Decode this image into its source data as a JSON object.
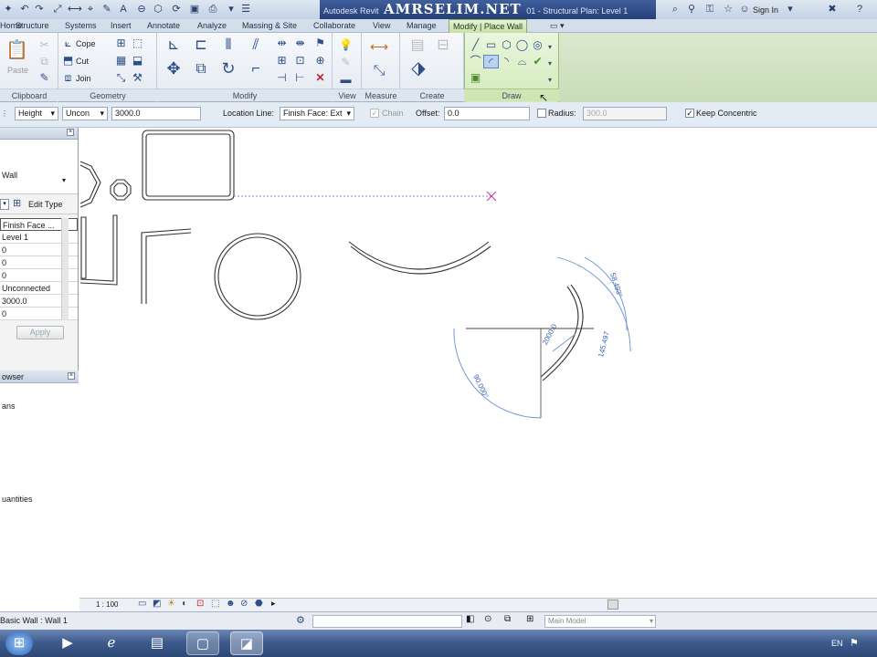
{
  "titlebar": {
    "app_text": "Autodesk Revit",
    "watermark": "AMRSELIM.NET",
    "doc_text": "01 - Structural Plan: Level 1",
    "sign_in": "Sign In",
    "quick_access_icons": [
      "app-menu-icon",
      "undo-icon",
      "redo-icon",
      "measure-icon",
      "text-annotation-icon",
      "section-icon",
      "3d-view-icon",
      "print-icon"
    ]
  },
  "tabs": [
    "Home",
    "Structure",
    "Systems",
    "Insert",
    "Annotate",
    "Analyze",
    "Massing & Site",
    "Collaborate",
    "View",
    "Manage",
    "Modify | Place Wall"
  ],
  "active_tab": "Modify | Place Wall",
  "ribbon": {
    "clipboard": {
      "label": "Clipboard",
      "paste": "Paste"
    },
    "geometry": {
      "label": "Geometry",
      "cope": "Cope",
      "cut": "Cut",
      "join": "Join"
    },
    "modify": {
      "label": "Modify"
    },
    "view": {
      "label": "View"
    },
    "measure": {
      "label": "Measure"
    },
    "create": {
      "label": "Create"
    },
    "draw": {
      "label": "Draw"
    }
  },
  "options_bar": {
    "height_select": "Height",
    "uncon_select": "Uncon",
    "height_value": "3000.0",
    "location_line_label": "Location Line:",
    "location_line_value": "Finish Face: Ext",
    "chain_label": "Chain",
    "offset_label": "Offset:",
    "offset_value": "0.0",
    "radius_label": "Radius:",
    "radius_value": "300.0",
    "keep_concentric_label": "Keep Concentric"
  },
  "properties": {
    "type_text": "Wall",
    "edit_type": "Edit Type",
    "rows": [
      "Finish Face ...",
      "Level 1",
      "0",
      "0",
      "0",
      "Unconnected",
      "3000.0",
      "0"
    ],
    "apply": "Apply"
  },
  "browser": {
    "title": "owser",
    "items": [
      "ans",
      "uantities"
    ]
  },
  "dimensions": {
    "angle_arc": "58.493°",
    "length_arc": "145.497",
    "offset_dim": "2000.0",
    "bottom_angle": "90.000°"
  },
  "view_control": {
    "scale": "1 : 100"
  },
  "status": {
    "text": "Basic Wall : Wall 1",
    "workset": "Main Model"
  },
  "tray": {
    "lang": "EN"
  },
  "colors": {
    "active_tab_green": "#c8e0a8",
    "title_blue": "#2d4a86",
    "dimension_blue": "#3d63b8",
    "snap_magenta": "#c0309a"
  }
}
